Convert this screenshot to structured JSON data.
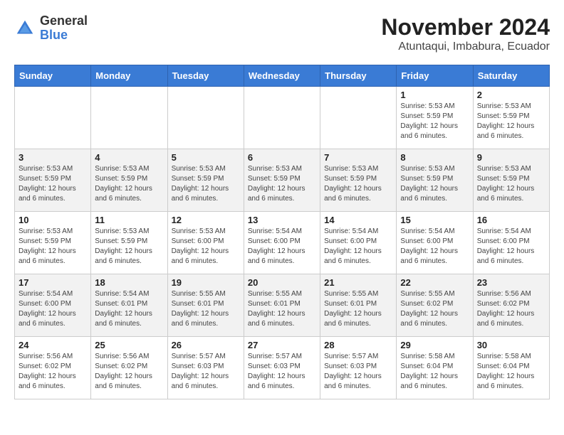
{
  "header": {
    "logo_general": "General",
    "logo_blue": "Blue",
    "month_year": "November 2024",
    "location": "Atuntaqui, Imbabura, Ecuador"
  },
  "days_of_week": [
    "Sunday",
    "Monday",
    "Tuesday",
    "Wednesday",
    "Thursday",
    "Friday",
    "Saturday"
  ],
  "weeks": [
    [
      {
        "day": "",
        "info": ""
      },
      {
        "day": "",
        "info": ""
      },
      {
        "day": "",
        "info": ""
      },
      {
        "day": "",
        "info": ""
      },
      {
        "day": "",
        "info": ""
      },
      {
        "day": "1",
        "info": "Sunrise: 5:53 AM\nSunset: 5:59 PM\nDaylight: 12 hours and 6 minutes."
      },
      {
        "day": "2",
        "info": "Sunrise: 5:53 AM\nSunset: 5:59 PM\nDaylight: 12 hours and 6 minutes."
      }
    ],
    [
      {
        "day": "3",
        "info": "Sunrise: 5:53 AM\nSunset: 5:59 PM\nDaylight: 12 hours and 6 minutes."
      },
      {
        "day": "4",
        "info": "Sunrise: 5:53 AM\nSunset: 5:59 PM\nDaylight: 12 hours and 6 minutes."
      },
      {
        "day": "5",
        "info": "Sunrise: 5:53 AM\nSunset: 5:59 PM\nDaylight: 12 hours and 6 minutes."
      },
      {
        "day": "6",
        "info": "Sunrise: 5:53 AM\nSunset: 5:59 PM\nDaylight: 12 hours and 6 minutes."
      },
      {
        "day": "7",
        "info": "Sunrise: 5:53 AM\nSunset: 5:59 PM\nDaylight: 12 hours and 6 minutes."
      },
      {
        "day": "8",
        "info": "Sunrise: 5:53 AM\nSunset: 5:59 PM\nDaylight: 12 hours and 6 minutes."
      },
      {
        "day": "9",
        "info": "Sunrise: 5:53 AM\nSunset: 5:59 PM\nDaylight: 12 hours and 6 minutes."
      }
    ],
    [
      {
        "day": "10",
        "info": "Sunrise: 5:53 AM\nSunset: 5:59 PM\nDaylight: 12 hours and 6 minutes."
      },
      {
        "day": "11",
        "info": "Sunrise: 5:53 AM\nSunset: 5:59 PM\nDaylight: 12 hours and 6 minutes."
      },
      {
        "day": "12",
        "info": "Sunrise: 5:53 AM\nSunset: 6:00 PM\nDaylight: 12 hours and 6 minutes."
      },
      {
        "day": "13",
        "info": "Sunrise: 5:54 AM\nSunset: 6:00 PM\nDaylight: 12 hours and 6 minutes."
      },
      {
        "day": "14",
        "info": "Sunrise: 5:54 AM\nSunset: 6:00 PM\nDaylight: 12 hours and 6 minutes."
      },
      {
        "day": "15",
        "info": "Sunrise: 5:54 AM\nSunset: 6:00 PM\nDaylight: 12 hours and 6 minutes."
      },
      {
        "day": "16",
        "info": "Sunrise: 5:54 AM\nSunset: 6:00 PM\nDaylight: 12 hours and 6 minutes."
      }
    ],
    [
      {
        "day": "17",
        "info": "Sunrise: 5:54 AM\nSunset: 6:00 PM\nDaylight: 12 hours and 6 minutes."
      },
      {
        "day": "18",
        "info": "Sunrise: 5:54 AM\nSunset: 6:01 PM\nDaylight: 12 hours and 6 minutes."
      },
      {
        "day": "19",
        "info": "Sunrise: 5:55 AM\nSunset: 6:01 PM\nDaylight: 12 hours and 6 minutes."
      },
      {
        "day": "20",
        "info": "Sunrise: 5:55 AM\nSunset: 6:01 PM\nDaylight: 12 hours and 6 minutes."
      },
      {
        "day": "21",
        "info": "Sunrise: 5:55 AM\nSunset: 6:01 PM\nDaylight: 12 hours and 6 minutes."
      },
      {
        "day": "22",
        "info": "Sunrise: 5:55 AM\nSunset: 6:02 PM\nDaylight: 12 hours and 6 minutes."
      },
      {
        "day": "23",
        "info": "Sunrise: 5:56 AM\nSunset: 6:02 PM\nDaylight: 12 hours and 6 minutes."
      }
    ],
    [
      {
        "day": "24",
        "info": "Sunrise: 5:56 AM\nSunset: 6:02 PM\nDaylight: 12 hours and 6 minutes."
      },
      {
        "day": "25",
        "info": "Sunrise: 5:56 AM\nSunset: 6:02 PM\nDaylight: 12 hours and 6 minutes."
      },
      {
        "day": "26",
        "info": "Sunrise: 5:57 AM\nSunset: 6:03 PM\nDaylight: 12 hours and 6 minutes."
      },
      {
        "day": "27",
        "info": "Sunrise: 5:57 AM\nSunset: 6:03 PM\nDaylight: 12 hours and 6 minutes."
      },
      {
        "day": "28",
        "info": "Sunrise: 5:57 AM\nSunset: 6:03 PM\nDaylight: 12 hours and 6 minutes."
      },
      {
        "day": "29",
        "info": "Sunrise: 5:58 AM\nSunset: 6:04 PM\nDaylight: 12 hours and 6 minutes."
      },
      {
        "day": "30",
        "info": "Sunrise: 5:58 AM\nSunset: 6:04 PM\nDaylight: 12 hours and 6 minutes."
      }
    ]
  ]
}
